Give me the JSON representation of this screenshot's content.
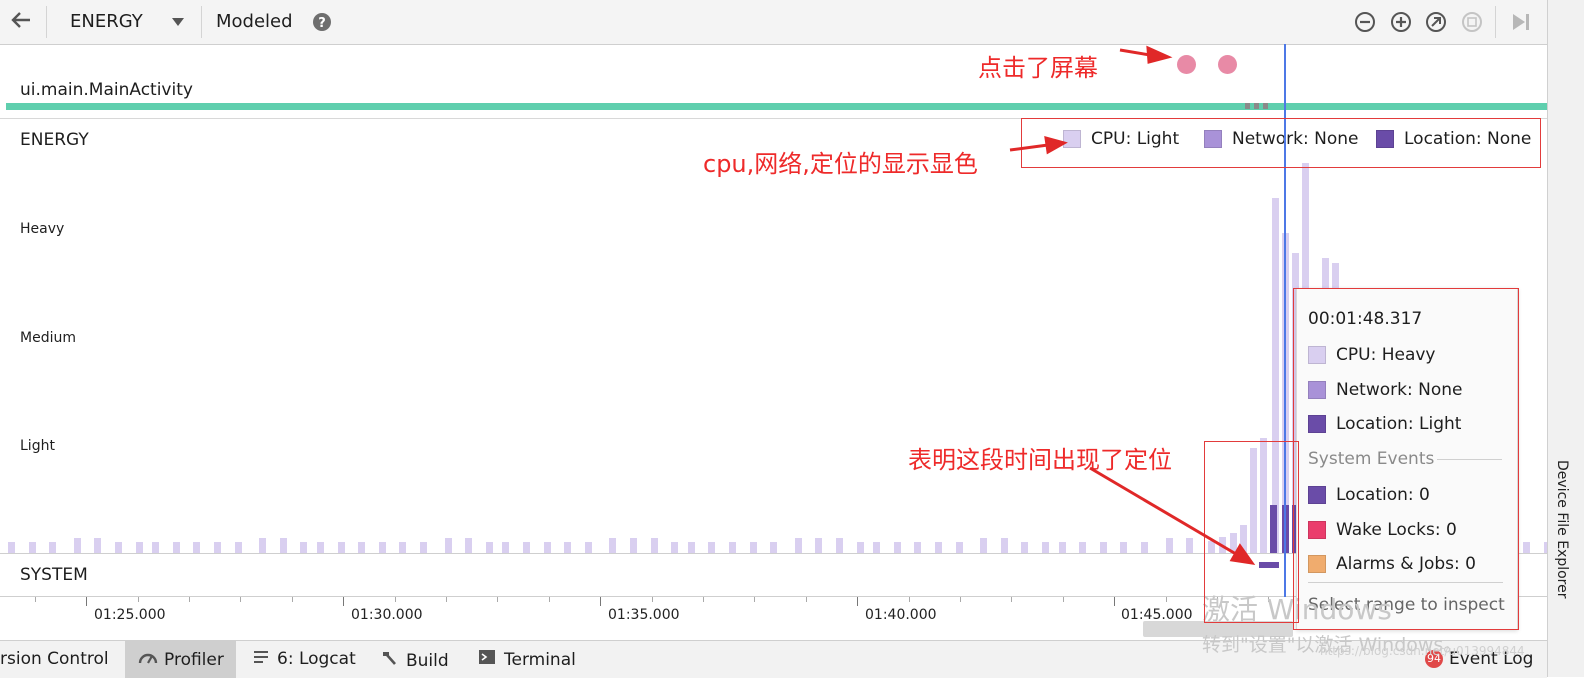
{
  "toolbar": {
    "back_icon": "arrow-left-icon",
    "session": "ENERGY",
    "mode": "Modeled",
    "help_icon": "question-icon",
    "zoom_out_icon": "zoom-out-icon",
    "zoom_in_icon": "zoom-in-icon",
    "reset_zoom_icon": "reset-zoom-icon",
    "zoom_selection_icon": "zoom-to-selection-icon",
    "go_live_icon": "go-live-icon"
  },
  "activity": {
    "label": "ui.main.MainActivity",
    "color": "#5fcfae"
  },
  "energy": {
    "title": "ENERGY",
    "levels": [
      "Heavy",
      "Medium",
      "Light"
    ],
    "legend": [
      {
        "label": "CPU: Light",
        "color": "#d9cff0"
      },
      {
        "label": "Network: None",
        "color": "#a992d8"
      },
      {
        "label": "Location: None",
        "color": "#6a4ca8"
      }
    ]
  },
  "system": {
    "title": "SYSTEM"
  },
  "time_axis": {
    "labels": [
      "01:25.000",
      "01:30.000",
      "01:35.000",
      "01:40.000",
      "01:45.000"
    ]
  },
  "tooltip": {
    "time": "00:01:48.317",
    "items": [
      {
        "label": "CPU: Heavy",
        "color": "#d9cff0"
      },
      {
        "label": "Network: None",
        "color": "#a992d8"
      },
      {
        "label": "Location: Light",
        "color": "#6a4ca8"
      }
    ],
    "section": "System Events",
    "events": [
      {
        "label": "Location: 0",
        "color": "#6a4ca8"
      },
      {
        "label": "Wake Locks:  0",
        "color": "#ea3d6c"
      },
      {
        "label": "Alarms & Jobs:  0",
        "color": "#f0ac6e"
      }
    ],
    "footer": "Select range to inspect"
  },
  "bottom_bar": {
    "items": [
      "rsion Control",
      "Profiler",
      "6: Logcat",
      "Build",
      "Terminal"
    ],
    "event_count": "94",
    "event_log": "Event Log"
  },
  "side_panel": {
    "label": "Device File Explorer"
  },
  "annotations": {
    "tap": "点击了屏幕",
    "legend_note": "cpu,网络,定位的显示显色",
    "location_note": "表明这段时间出现了定位"
  },
  "watermark": {
    "line1": "激活 Windows",
    "line2": "转到\"设置\"以激活 Windows。",
    "url": "https://blog.csdn.net/u013994844"
  }
}
